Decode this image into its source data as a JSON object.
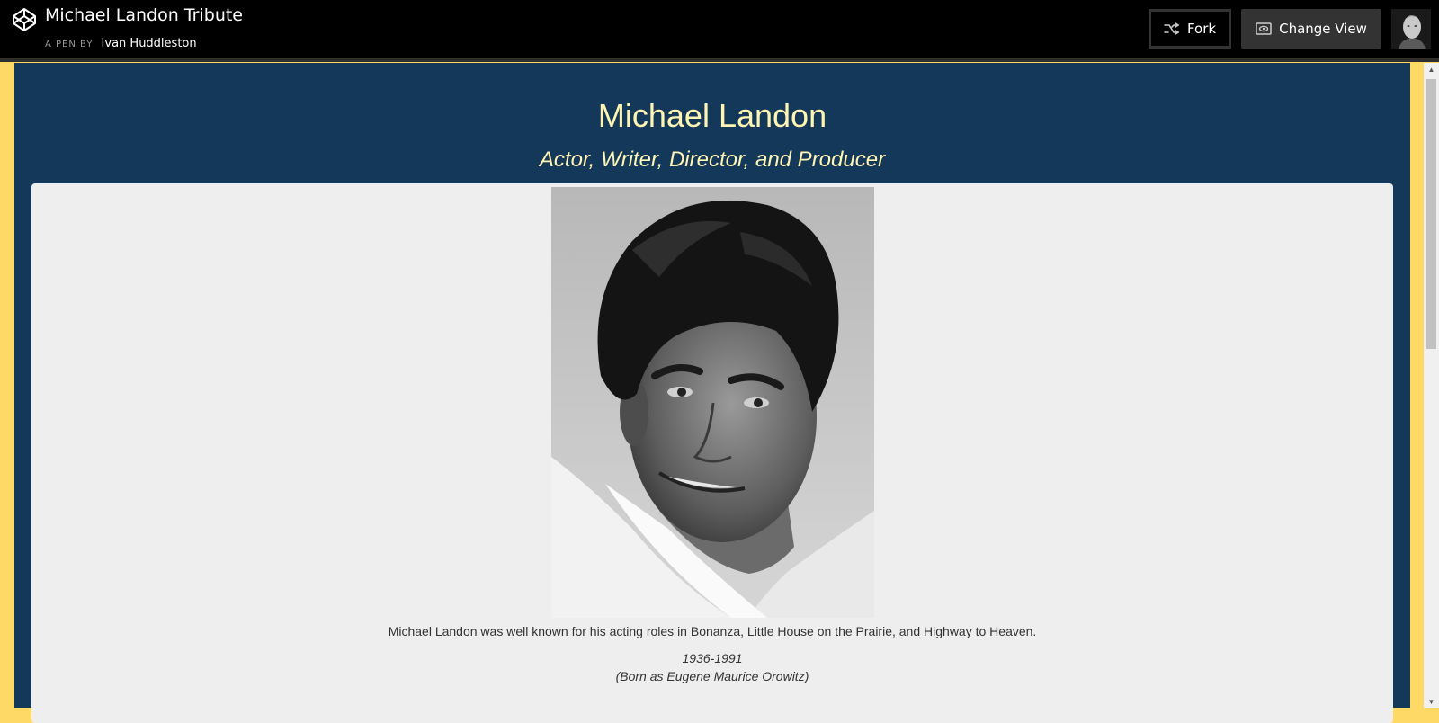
{
  "header": {
    "pen_title": "Michael Landon Tribute",
    "pen_by_label": "A PEN BY",
    "author": "Ivan Huddleston",
    "fork_label": "Fork",
    "change_view_label": "Change View"
  },
  "icons": {
    "logo": "codepen-logo-icon",
    "fork": "fork-icon",
    "change_view": "eye-icon"
  },
  "page": {
    "title": "Michael Landon",
    "subtitle": "Actor, Writer, Director, and Producer",
    "caption": "Michael Landon was well known for his acting roles in Bonanza, Little House on the Prairie, and Highway to Heaven.",
    "years": "1936-1991",
    "born": "(Born as Eugene Maurice Orowitz)"
  },
  "colors": {
    "header_bg": "#000000",
    "page_bg": "#13385a",
    "border_accent": "#ffd966",
    "title_color": "#fff5b3",
    "card_bg": "#eeeeee"
  }
}
